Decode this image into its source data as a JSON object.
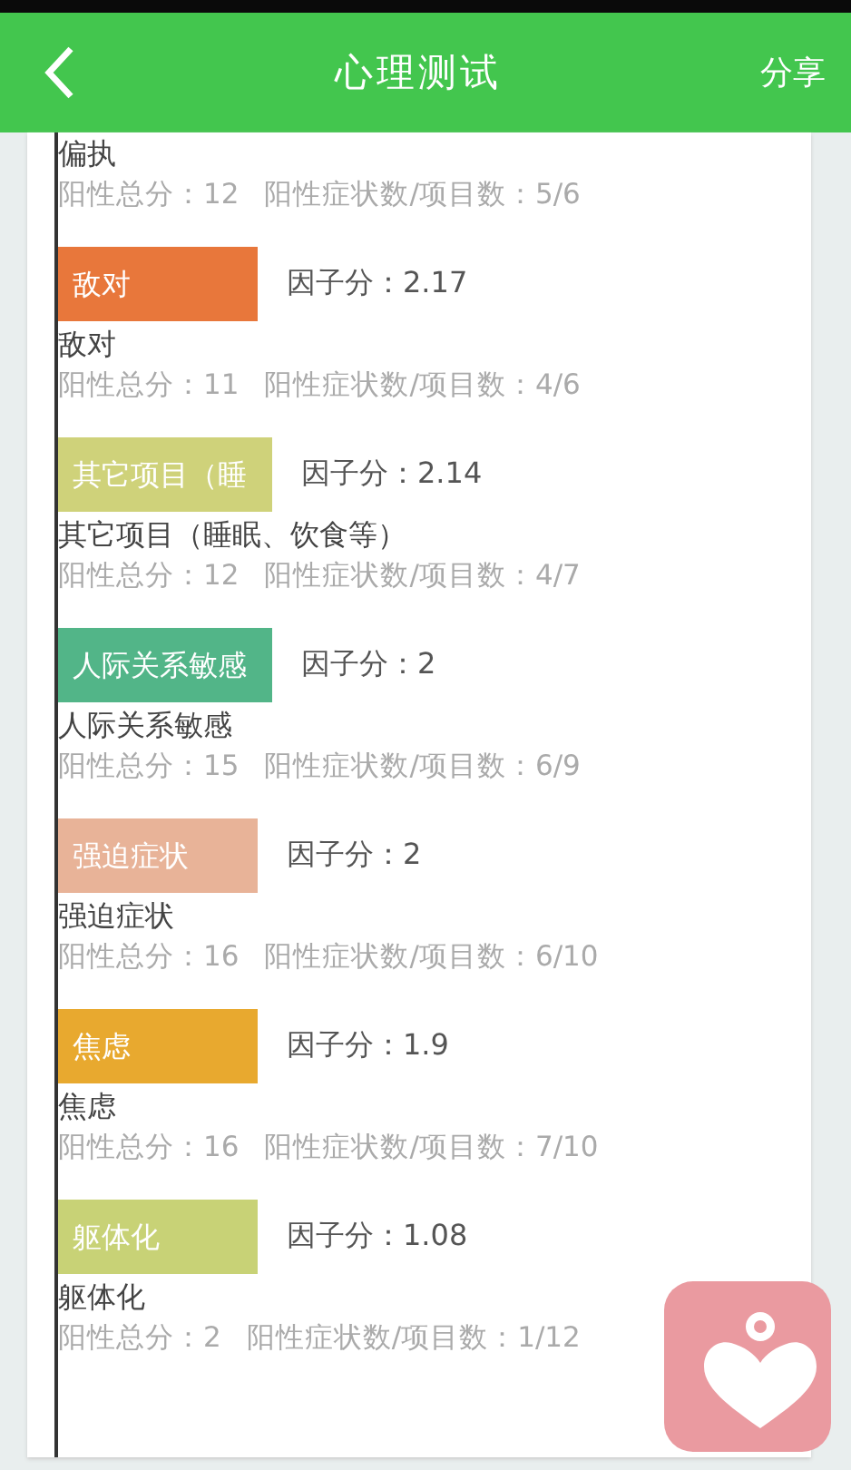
{
  "header": {
    "title": "心理测试",
    "share": "分享"
  },
  "items": [
    {
      "name": "偏执",
      "total": "阳性总分：12",
      "ratio": "阳性症状数/项目数：5/6"
    },
    {
      "bar": {
        "label": "敌对",
        "color": "#e8773b"
      },
      "score": "因子分：2.17",
      "name": "敌对",
      "total": "阳性总分：11",
      "ratio": "阳性症状数/项目数：4/6"
    },
    {
      "bar": {
        "label": "其它项目（睡",
        "color": "#cfd27a"
      },
      "score": "因子分：2.14",
      "name": "其它项目（睡眠、饮食等）",
      "total": "阳性总分：12",
      "ratio": "阳性症状数/项目数：4/7"
    },
    {
      "bar": {
        "label": "人际关系敏感",
        "color": "#52b588"
      },
      "score": "因子分：2",
      "name": "人际关系敏感",
      "total": "阳性总分：15",
      "ratio": "阳性症状数/项目数：6/9"
    },
    {
      "bar": {
        "label": "强迫症状",
        "color": "#e8b398"
      },
      "score": "因子分：2",
      "name": "强迫症状",
      "total": "阳性总分：16",
      "ratio": "阳性症状数/项目数：6/10"
    },
    {
      "bar": {
        "label": "焦虑",
        "color": "#e8a92f"
      },
      "score": "因子分：1.9",
      "name": "焦虑",
      "total": "阳性总分：16",
      "ratio": "阳性症状数/项目数：7/10"
    },
    {
      "bar": {
        "label": "躯体化",
        "color": "#c8d276"
      },
      "score": "因子分：1.08",
      "name": "躯体化",
      "total": "阳性总分：2",
      "ratio": "阳性症状数/项目数：1/12"
    }
  ]
}
